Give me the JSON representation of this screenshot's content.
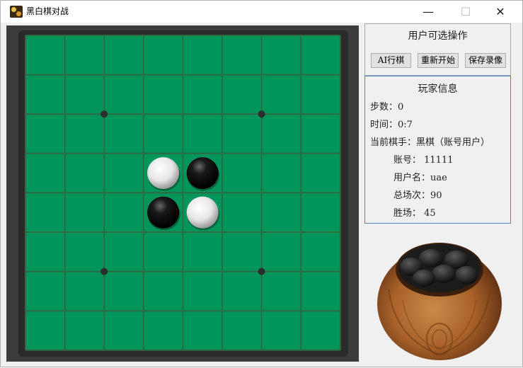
{
  "window": {
    "title": "黑白棋对战",
    "minimize_glyph": "—",
    "maximize_glyph": "☐",
    "close_glyph": "✕"
  },
  "board": {
    "size": 8,
    "color": "#00955a",
    "line_color": "#2f6a42",
    "star_points": [
      [
        2,
        2
      ],
      [
        2,
        6
      ],
      [
        6,
        2
      ],
      [
        6,
        6
      ]
    ],
    "stones": [
      {
        "row": 3,
        "col": 3,
        "color": "white"
      },
      {
        "row": 3,
        "col": 4,
        "color": "black"
      },
      {
        "row": 4,
        "col": 3,
        "color": "black"
      },
      {
        "row": 4,
        "col": 4,
        "color": "white"
      }
    ]
  },
  "ops": {
    "title": "用户可选操作",
    "buttons": [
      "AI行棋",
      "重新开始",
      "保存录像"
    ]
  },
  "info": {
    "title": "玩家信息",
    "steps": "步数：0",
    "time": "时间：0:7",
    "current_player": "当前棋手：黑棋（账号用户）",
    "account": "账号：   11111",
    "username": "用户名：uae",
    "total_games": "总场次：90",
    "wins": "胜场：   45"
  },
  "icons": {
    "app": "reversi-app-icon",
    "jar": "stone-jar-icon"
  }
}
